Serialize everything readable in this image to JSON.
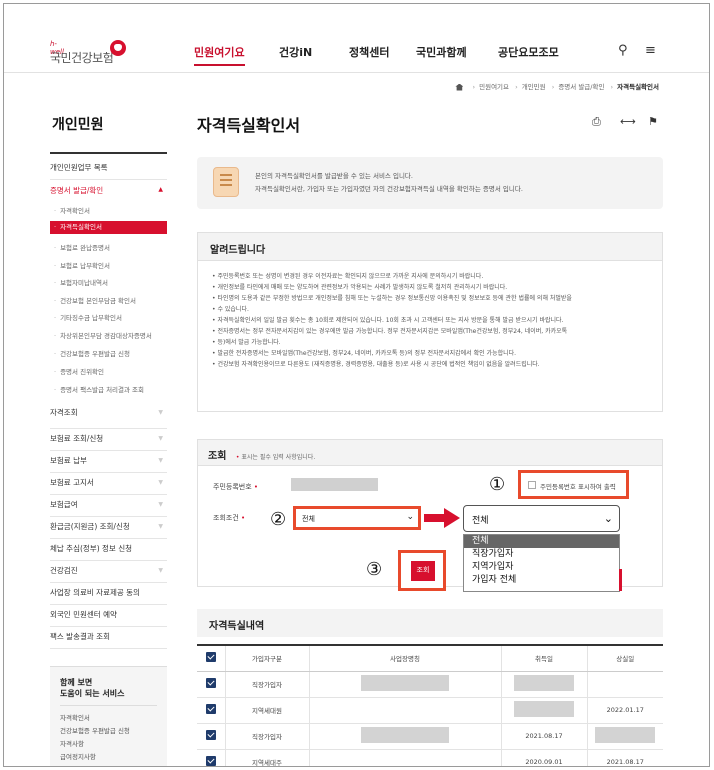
{
  "header": {
    "logo_small": "h-well",
    "logo_main": "국민건강보험",
    "nav": [
      "민원여기요",
      "건강iN",
      "정책센터",
      "국민과함께",
      "공단요모조모"
    ],
    "search_icon": "search-icon",
    "menu_icon": "hamburger-menu-icon"
  },
  "breadcrumb": [
    "민원여기요",
    "개인민원",
    "증명서 발급/확인",
    "자격득실확인서"
  ],
  "sidebar": {
    "title": "개인민원",
    "items": [
      {
        "label": "개인민원업무 목록"
      },
      {
        "label": "증명서 발급/확인",
        "active": true
      }
    ],
    "subitems": [
      "자격확인서",
      "자격득실확인서",
      "보험료 완납증명서",
      "보험료 납부확인서",
      "보험자미납내역서",
      "건강보험 본인부담금 확인서",
      "기타징수금 납부확인서",
      "차상위본인부담 경감대상자증명서",
      "건강보험증 우편발급 신청",
      "증명서 진위확인",
      "증명서 팩스발급 처리결과 조회"
    ],
    "items2": [
      "자격조회",
      "보험료 조회/신청",
      "보험료 납부",
      "보험료 고지서",
      "보험급여",
      "환급금(지원금) 조회/신청",
      "체납 추심(정부) 정보 신청",
      "건강검진",
      "사업장 의료비 자료제공 동의",
      "외국인 민원센터 예약",
      "팩스 발송결과 조회"
    ],
    "aside_title1": "함께 보면",
    "aside_title2": "도움이 되는 서비스",
    "aside_links": [
      "자격확인서",
      "건강보험증 우편발급 신청",
      "자격사항",
      "급여정지사항"
    ]
  },
  "main": {
    "title": "자격득실확인서",
    "intro_line1": "본인의 자격득실확인서를 발급받을 수 있는 서비스 입니다.",
    "intro_line2": "자격득실확인서란, 가입자 또는 가입자였던 자의 건강보험자격득실 내역을 확인하는 증명서 입니다.",
    "notice_title": "알려드립니다",
    "notices": [
      "주민등록번호 또는 성명이 변경된 경우 이전자료는 확인되지 않으므로 가까운 지사에 문의하시기 바랍니다.",
      "개인정보를 타인에게 매매 또는 양도하여 관련정보가 악용되는 사례가 발생하지 않도록 철저히 관리하시기 바랍니다.",
      "타인명의 도용과 같은 부정한 방법으로 개인정보를 침해 또는 누설하는 경우 정보통신망 이용촉진 및 정보보호 등에 관한 법률에 의해 처벌받을",
      "수 있습니다.",
      "자격득실확인서의 일일 발급 횟수는 총 10회로 제한되어 있습니다. 10회 초과 시 고객센터 또는 지사 방문을 통해 발급 받으시기 바랍니다.",
      "전자증명서는 정부 전자문서지갑이 있는 경우에만 발급 가능합니다. 정부 전자문서지갑은 모바일앱(The건강보험, 정부24, 네이버, 카카오톡",
      "등)에서 발급 가능합니다.",
      "발급한 전자증명서는 모바일앱(The건강보험, 정부24, 네이버, 카카오톡 등)의 정부 전자문서지갑에서 확인 가능합니다.",
      "건강보험 자격확인용이므로 다른용도 (재직증명용, 경력증명용, 대출용 등)로 사용 시 공단에 법적인 책임이 없음을 알려드립니다."
    ],
    "search_title": "조회",
    "search_hint_mark": "•",
    "search_hint": "표시는 필수 입력 사항입니다.",
    "rrn_label": "주민등록번호",
    "rrn_checkbox": "주민등록번호 표시하여 출력",
    "cond_label": "조회조건",
    "cond_value": "전체",
    "dropdown_value": "전체",
    "dropdown_options": [
      "전체",
      "직장가입자",
      "지역가입자",
      "가입자 전체"
    ],
    "search_button": "조회",
    "markers": [
      "①",
      "②",
      "③"
    ],
    "result_title": "자격득실내역",
    "table_headers": [
      "가입자구분",
      "사업장명칭",
      "취득일",
      "상실일"
    ],
    "rows": [
      {
        "type": "직장가입자",
        "acq": "",
        "loss": ""
      },
      {
        "type": "지역세대원",
        "acq": "",
        "loss": "2022.01.17"
      },
      {
        "type": "직장가입자",
        "acq": "2021.08.17",
        "loss": ""
      },
      {
        "type": "지역세대주",
        "acq": "2020.09.01",
        "loss": "2021.08.17"
      }
    ]
  },
  "colors": {
    "brand": "#d7102e",
    "highlight": "#e84a2c"
  }
}
